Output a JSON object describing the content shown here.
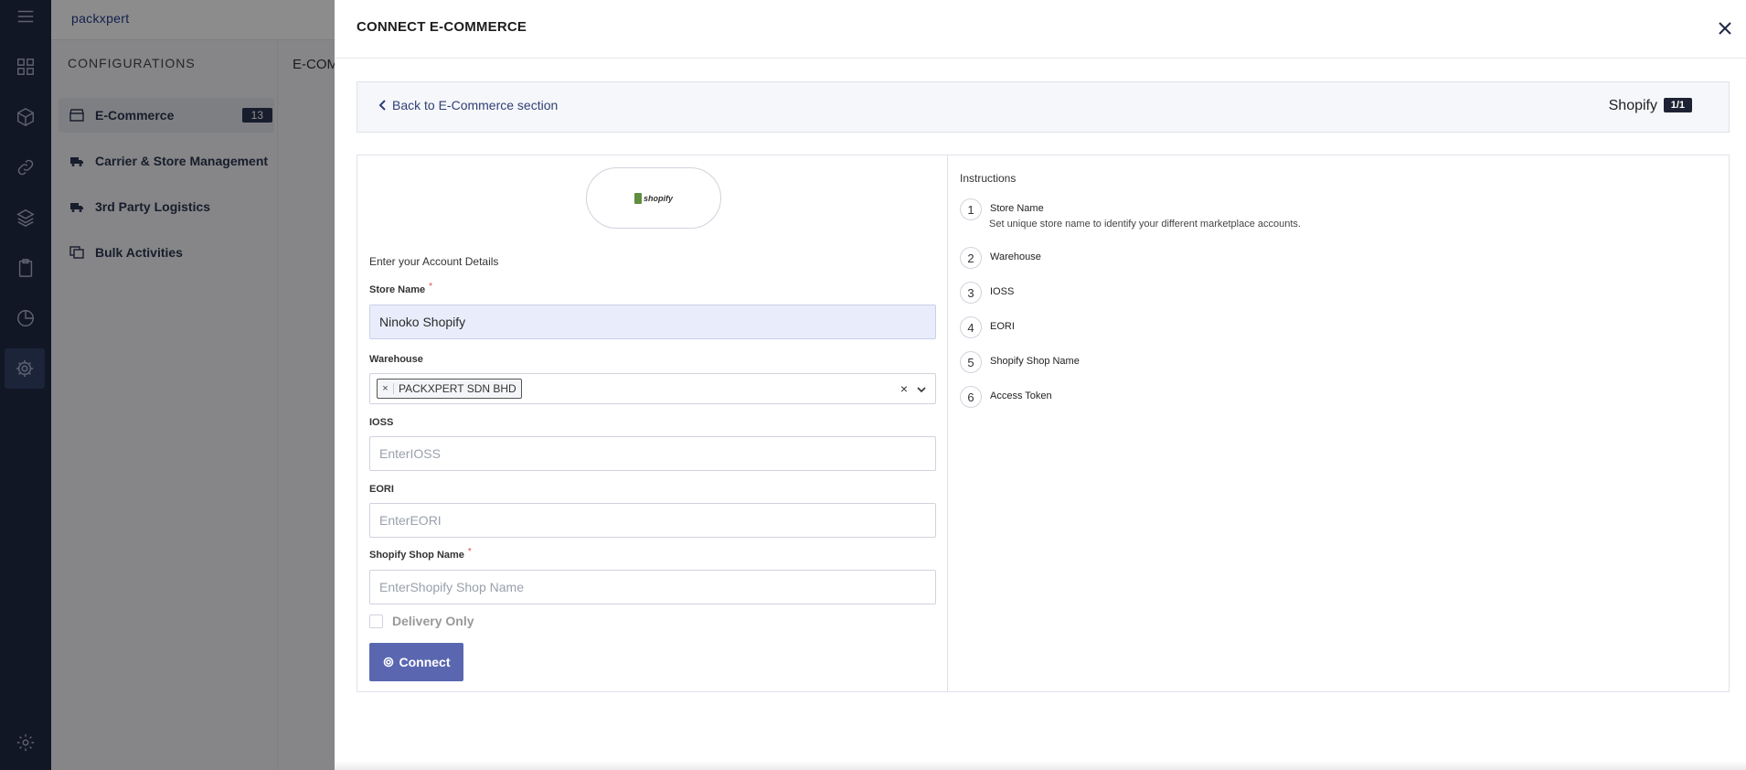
{
  "app": {
    "logo": "packxpert"
  },
  "config_sidebar": {
    "title": "CONFIGURATIONS",
    "items": [
      {
        "label": "E-Commerce",
        "badge": "13",
        "icon": "store-icon"
      },
      {
        "label": "Carrier & Store Management",
        "icon": "truck-icon"
      },
      {
        "label": "3rd Party Logistics",
        "icon": "truck-icon"
      },
      {
        "label": "Bulk Activities",
        "icon": "copy-icon"
      }
    ]
  },
  "background": {
    "heading": "E-COM"
  },
  "drawer": {
    "title": "CONNECT E-COMMERCE",
    "back_link": "Back to E-Commerce section",
    "shop_name": "Shopify",
    "shop_count": "1/1",
    "logo_text": "shopify",
    "form": {
      "section_label": "Enter your Account Details",
      "store_name": {
        "label": "Store Name",
        "required": "*",
        "value": "Ninoko Shopify"
      },
      "warehouse": {
        "label": "Warehouse",
        "chip": "PACKXPERT SDN BHD",
        "chip_remove": "×",
        "clear": "×"
      },
      "ioss": {
        "label": "IOSS",
        "placeholder": "EnterIOSS"
      },
      "eori": {
        "label": "EORI",
        "placeholder": "EnterEORI"
      },
      "shop_name": {
        "label": "Shopify Shop Name",
        "required": "*",
        "placeholder": "EnterShopify Shop Name"
      },
      "delivery_only": "Delivery Only",
      "connect_button": "Connect"
    },
    "instructions": {
      "title": "Instructions",
      "steps": [
        {
          "num": "1",
          "name": "Store Name",
          "desc": "Set unique store name to identify your different marketplace accounts."
        },
        {
          "num": "2",
          "name": "Warehouse"
        },
        {
          "num": "3",
          "name": "IOSS"
        },
        {
          "num": "4",
          "name": "EORI"
        },
        {
          "num": "5",
          "name": "Shopify Shop Name"
        },
        {
          "num": "6",
          "name": "Access Token"
        }
      ]
    }
  },
  "colors": {
    "rail": "#1f2a44",
    "accent": "#5a67b0",
    "filled_input": "#e9edfb"
  }
}
